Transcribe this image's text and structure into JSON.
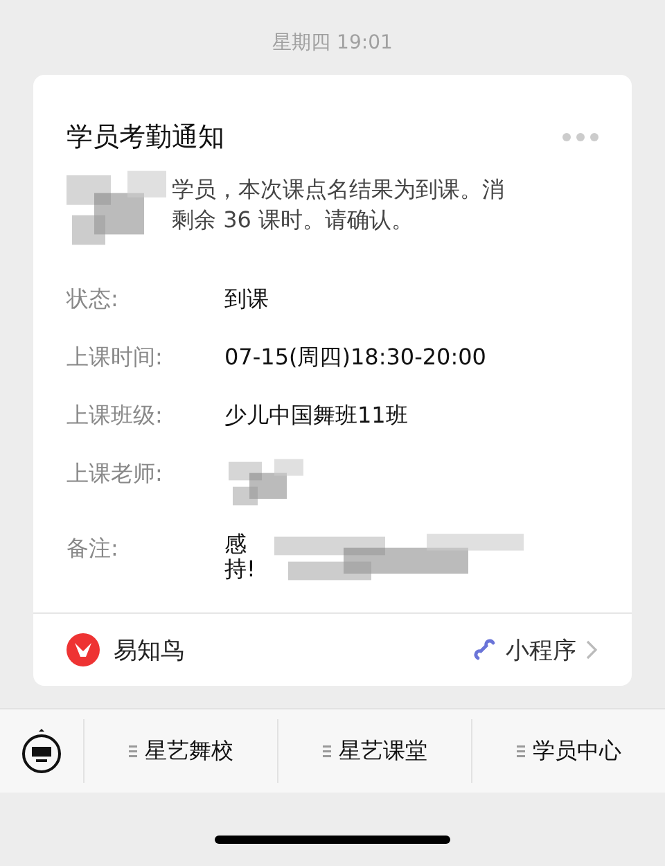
{
  "timestamp": "星期四 19:01",
  "card": {
    "title": "学员考勤通知",
    "message_lines": [
      "学员，本次课点名结果为到课。消",
      "剩余 36 课时。请确认。"
    ],
    "fields": [
      {
        "label": "状态:",
        "value_lines": [
          "到课"
        ]
      },
      {
        "label": "上课时间:",
        "value_lines": [
          "07-15(周四)18:30-20:00"
        ]
      },
      {
        "label": "上课班级:",
        "value_lines": [
          "少儿中国舞班11班"
        ]
      },
      {
        "label": "上课老师:"
      },
      {
        "label": "备注:",
        "value_lines": [
          "感",
          "持!"
        ]
      }
    ],
    "source": {
      "name": "易知鸟",
      "link": "小程序"
    }
  },
  "menu": [
    {
      "label": "星艺舞校"
    },
    {
      "label": "星艺课堂"
    },
    {
      "label": "学员中心"
    }
  ]
}
